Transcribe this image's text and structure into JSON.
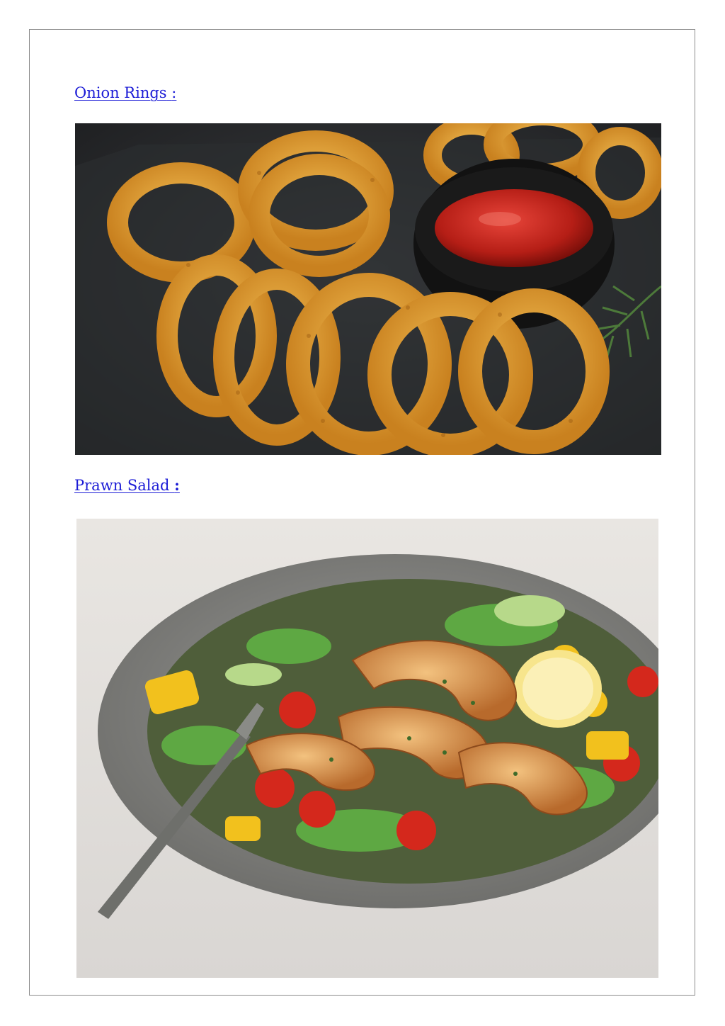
{
  "sections": [
    {
      "heading": "Onion Rings",
      "colon": ":",
      "photo_icon": "onion-rings-photo"
    },
    {
      "heading": "Prawn Salad",
      "colon": ":",
      "photo_icon": "prawn-salad-photo"
    }
  ]
}
